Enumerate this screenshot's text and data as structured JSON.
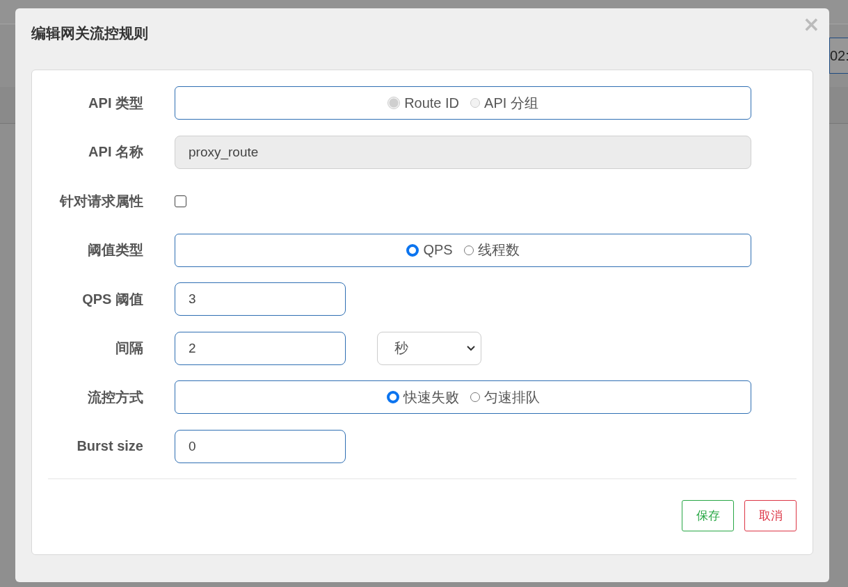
{
  "background": {
    "field_value": "02:"
  },
  "dialog": {
    "title": "编辑网关流控规则",
    "close": "×"
  },
  "rows": [
    {
      "kind": "radio",
      "label": "API 类型",
      "disabled": true,
      "options": [
        {
          "label": "Route ID",
          "selected": true
        },
        {
          "label": "API 分组",
          "selected": false
        }
      ]
    },
    {
      "kind": "text",
      "label": "API 名称",
      "value": "proxy_route",
      "readonly": true
    },
    {
      "kind": "checkbox",
      "label": "针对请求属性",
      "checked": false
    },
    {
      "kind": "radio",
      "label": "阈值类型",
      "disabled": false,
      "options": [
        {
          "label": "QPS",
          "selected": true
        },
        {
          "label": "线程数",
          "selected": false
        }
      ]
    },
    {
      "kind": "text",
      "label": "QPS 阈值",
      "value": "3",
      "readonly": false
    },
    {
      "kind": "text_select",
      "label": "间隔",
      "value": "2",
      "unit": "秒"
    },
    {
      "kind": "radio",
      "label": "流控方式",
      "disabled": false,
      "options": [
        {
          "label": "快速失败",
          "selected": true
        },
        {
          "label": "匀速排队",
          "selected": false
        }
      ]
    },
    {
      "kind": "text",
      "label": "Burst size",
      "value": "0",
      "readonly": false
    }
  ],
  "buttons": [
    {
      "kind": "save",
      "label": "保存"
    },
    {
      "kind": "cancel",
      "label": "取消"
    }
  ]
}
